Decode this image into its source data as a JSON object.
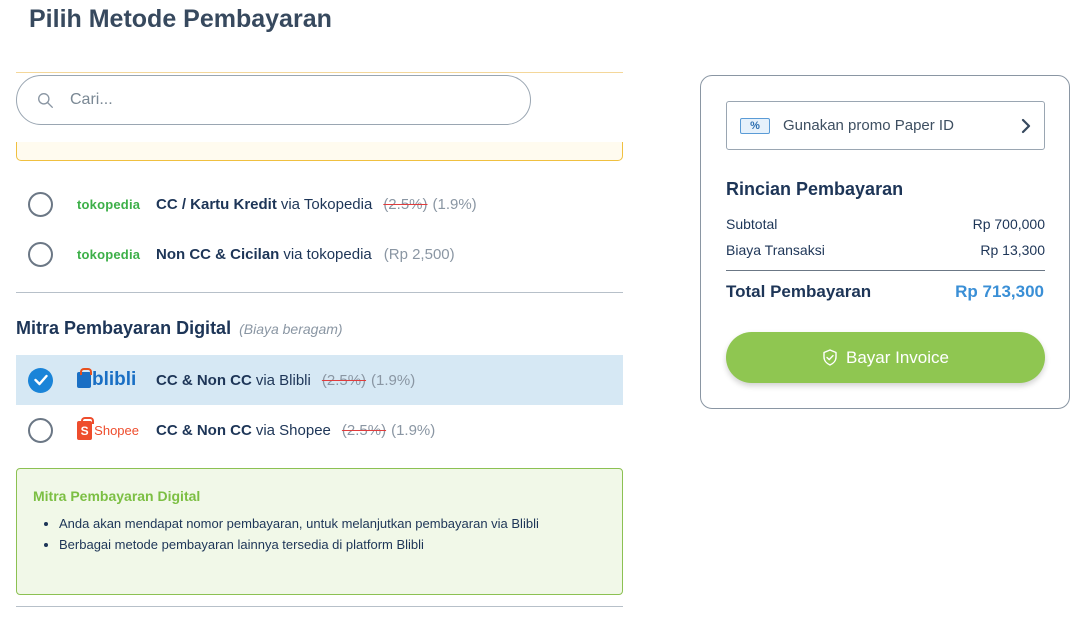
{
  "page": {
    "title": "Pilih Metode Pembayaran"
  },
  "search": {
    "placeholder": "Cari...",
    "value": ""
  },
  "payment_methods": [
    {
      "logo_text": "tokopedia",
      "name": "CC / Kartu Kredit",
      "via": "via Tokopedia",
      "fee_old": "(2.5%)",
      "fee_new": "(1.9%)",
      "selected": false
    },
    {
      "logo_text": "tokopedia",
      "name": "Non CC & Cicilan",
      "via": "via tokopedia",
      "fee_flat": "(Rp 2,500)",
      "selected": false
    }
  ],
  "digital_section": {
    "title": "Mitra Pembayaran Digital",
    "note": "(Biaya beragam)",
    "methods": [
      {
        "logo_text": "blibli",
        "name": "CC & Non CC",
        "via": "via Blibli",
        "fee_old": "(2.5%)",
        "fee_new": "(1.9%)",
        "selected": true
      },
      {
        "logo_text": "Shopee",
        "logo_letter": "S",
        "name": "CC & Non CC",
        "via": "via Shopee",
        "fee_old": "(2.5%)",
        "fee_new": "(1.9%)",
        "selected": false
      }
    ],
    "info": {
      "title": "Mitra Pembayaran Digital",
      "points": [
        "Anda akan mendapat nomor pembayaran, untuk melanjutkan pembayaran via Blibli",
        "Berbagai metode pembayaran lainnya tersedia di platform Blibli"
      ]
    }
  },
  "summary": {
    "promo_label": "Gunakan promo Paper ID",
    "promo_icon_text": "%",
    "title": "Rincian Pembayaran",
    "subtotal_label": "Subtotal",
    "subtotal_value": "Rp 700,000",
    "fee_label": "Biaya Transaksi",
    "fee_value": "Rp 13,300",
    "total_label": "Total Pembayaran",
    "total_value": "Rp 713,300",
    "pay_button": "Bayar Invoice"
  },
  "icons": {
    "search": "search-icon",
    "chevron": "chevron-right-icon",
    "check": "check-icon",
    "shield": "shield-check-icon",
    "promo": "promo-ticket-icon"
  },
  "colors": {
    "accent_blue": "#1a84d8",
    "selected_row": "#d6e8f4",
    "pay_button": "#8fc651",
    "total_value": "#3a8fd6",
    "info_green": "#7cbf43",
    "strike_red": "#e03c3c"
  }
}
